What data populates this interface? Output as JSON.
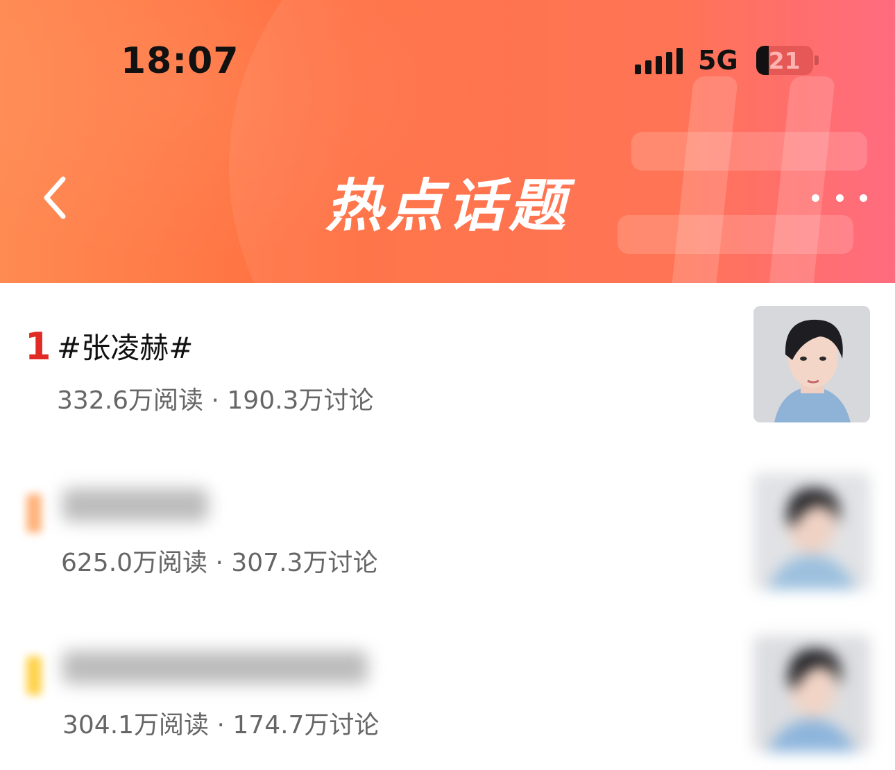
{
  "status_bar": {
    "time": "18:07",
    "network": "5G",
    "battery": "21"
  },
  "header": {
    "title": "热点话题",
    "back_icon": "chevron-left-icon",
    "more_icon": "more-horizontal-icon"
  },
  "topics": [
    {
      "rank": "1",
      "title": "#张凌赫#",
      "stats": "332.6万阅读 · 190.3万讨论"
    },
    {
      "rank": "",
      "title": "",
      "stats": "625.0万阅读 · 307.3万讨论"
    },
    {
      "rank": "",
      "title": "",
      "stats": "304.1万阅读 · 174.7万讨论"
    }
  ],
  "colors": {
    "rank1": "#e02a23",
    "rank2": "#ffb27a",
    "rank3": "#ffd24a"
  }
}
